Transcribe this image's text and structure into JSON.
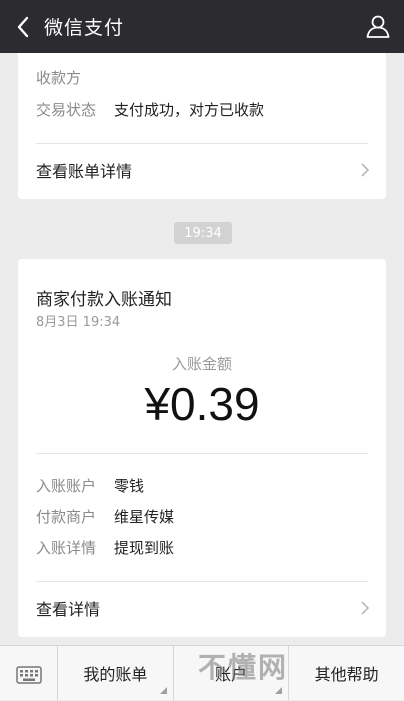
{
  "header": {
    "title": "微信支付"
  },
  "card1": {
    "partial_label": "收款方",
    "status_label": "交易状态",
    "status_value": "支付成功，对方已收款",
    "detail_link": "查看账单详情"
  },
  "time_pill": "19:34",
  "card2": {
    "title": "商家付款入账通知",
    "date": "8月3日  19:34",
    "amount_label": "入账金额",
    "amount": "¥0.39",
    "rows": [
      {
        "label": "入账账户",
        "value": "零钱"
      },
      {
        "label": "付款商户",
        "value": "维星传媒"
      },
      {
        "label": "入账详情",
        "value": "提现到账"
      }
    ],
    "detail_link": "查看详情"
  },
  "bottom_menu": {
    "items": [
      "我的账单",
      "账户",
      "其他帮助"
    ]
  },
  "watermark": "不懂网"
}
